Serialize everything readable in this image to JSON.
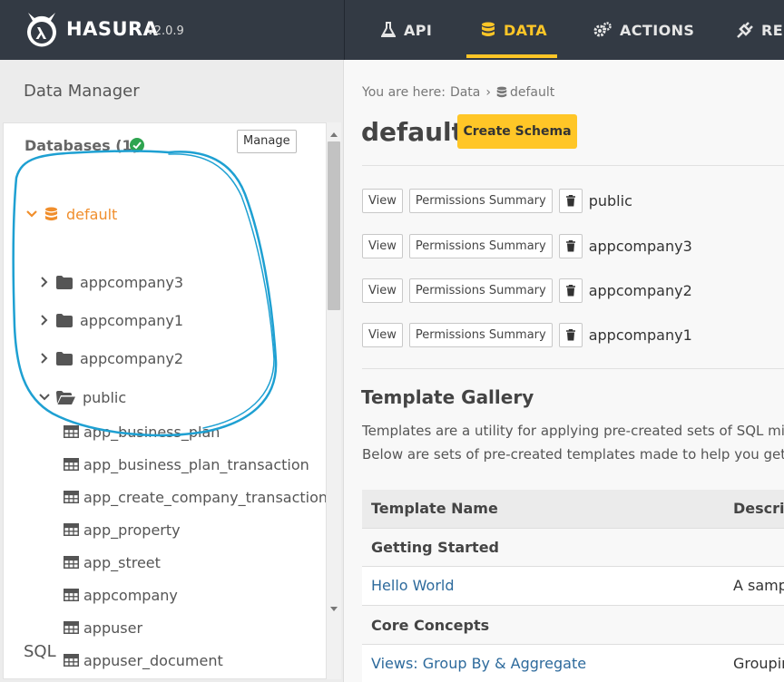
{
  "header": {
    "brand": "HASURA",
    "version": "v2.0.9",
    "nav": [
      {
        "label": "API",
        "icon": "flask-icon",
        "active": false
      },
      {
        "label": "DATA",
        "icon": "database-icon",
        "active": true
      },
      {
        "label": "ACTIONS",
        "icon": "gears-icon",
        "active": false
      },
      {
        "label": "RE",
        "icon": "plug-icon",
        "active": false
      }
    ],
    "accent": "#ffc627",
    "background": "#333a44"
  },
  "sidebar": {
    "title": "Data Manager",
    "databases_heading": "Databases (1)",
    "manage_label": "Manage",
    "database": {
      "name": "default",
      "color": "#f08e2c"
    },
    "schemas": [
      "appcompany3",
      "appcompany1",
      "appcompany2"
    ],
    "expanded_schema": "public",
    "tables": [
      "app_business_plan",
      "app_business_plan_transaction",
      "app_create_company_transaction",
      "app_property",
      "app_street",
      "appcompany",
      "appuser",
      "appuser_document"
    ],
    "sql_label": "SQL"
  },
  "main": {
    "breadcrumb": {
      "prefix": "You are here:",
      "section": "Data",
      "current": "default"
    },
    "title": "default",
    "create_schema_label": "Create Schema",
    "view_label": "View",
    "permissions_label": "Permissions Summary",
    "schema_rows": [
      "public",
      "appcompany3",
      "appcompany2",
      "appcompany1"
    ],
    "template_gallery": {
      "title": "Template Gallery",
      "desc_line1": "Templates are a utility for applying pre-created sets of SQL mig",
      "desc_line2": "Below are sets of pre-created templates made to help you get u",
      "col_name": "Template Name",
      "col_desc": "Descrip",
      "rows": [
        {
          "kind": "group",
          "name": "Getting Started"
        },
        {
          "kind": "item",
          "name": "Hello World",
          "desc": "A samp"
        },
        {
          "kind": "group",
          "name": "Core Concepts"
        },
        {
          "kind": "item",
          "name": "Views: Group By & Aggregate",
          "desc": "Groupin"
        }
      ]
    }
  }
}
